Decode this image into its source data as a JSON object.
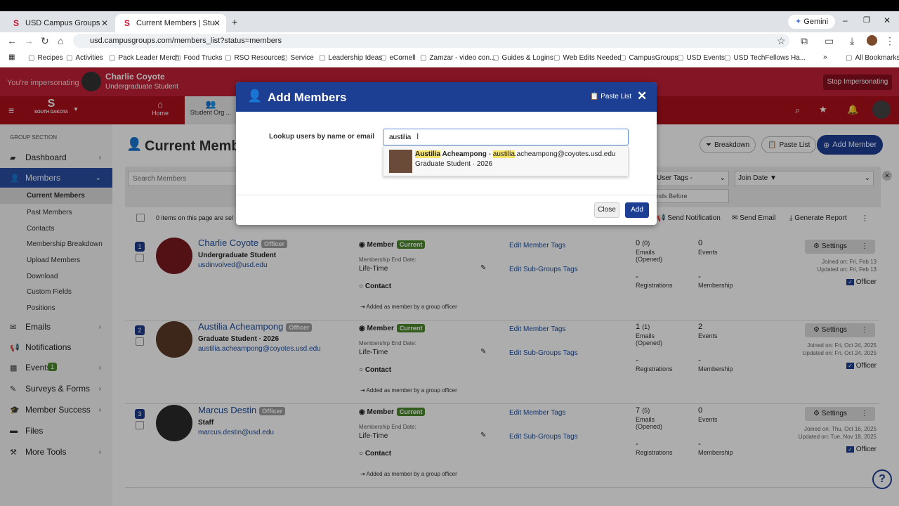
{
  "browser": {
    "tabs": [
      {
        "label": "USD Campus Groups"
      },
      {
        "label": "Current Members | Student Org"
      }
    ],
    "gemini_label": "Gemini",
    "url": "usd.campusgroups.com/members_list?status=members",
    "bookmarks": [
      "Recipes",
      "Activities",
      "Pack Leader Merch",
      "Food Trucks",
      "RSO Resources",
      "Service",
      "Leadership Ideas",
      "eCornell",
      "Zamzar - video con...",
      "Guides & Logins",
      "Web Edits Needed",
      "CampusGroups",
      "USD Events",
      "USD TechFellows Ha...",
      "All Bookmarks"
    ]
  },
  "impersonation": {
    "label": "You're impersonating",
    "user_name": "Charlie Coyote",
    "user_role": "Undergraduate Student",
    "stop_button": "Stop Impersonating"
  },
  "nav": {
    "home": "Home",
    "student_org": "Student Org ..."
  },
  "sidebar": {
    "section_header": "GROUP SECTION",
    "items": [
      {
        "label": "Dashboard"
      },
      {
        "label": "Members"
      },
      {
        "label": "Emails"
      },
      {
        "label": "Notifications"
      },
      {
        "label": "Events",
        "badge": "1"
      },
      {
        "label": "Surveys & Forms"
      },
      {
        "label": "Member Success"
      },
      {
        "label": "Files"
      },
      {
        "label": "More Tools"
      }
    ],
    "sub_items": [
      "Current Members",
      "Past Members",
      "Contacts",
      "Membership Breakdown",
      "Upload Members",
      "Download",
      "Custom Fields",
      "Positions"
    ]
  },
  "main": {
    "title": "Current Members",
    "breakdown": "Breakdown",
    "paste_list": "Paste List",
    "add_member": "Add Member",
    "search_placeholder": "Search Members",
    "user_tags": "User Tags -",
    "join_date": "Join Date ▼",
    "ends_before": "nds Before",
    "selected_text": "0 items on this page are sel",
    "send_notification": "Send Notification",
    "send_email": "Send Email",
    "generate_report": "Generate Report",
    "members": [
      {
        "num": "1",
        "name": "Charlie Coyote",
        "badge": "Officer",
        "role": "Undergraduate Student",
        "email": "usdinvolved@usd.edu",
        "member_label": "Member",
        "status": "Current",
        "end_label": "Membership End Date:",
        "end_value": "Life-Time",
        "contact": "Contact",
        "added": "Added as member by a group officer",
        "edit_tags": "Edit Member Tags",
        "edit_subgroups": "Edit Sub-Groups Tags",
        "emails_count": "0",
        "emails_opened": "(0)",
        "emails_label": "Emails (Opened)",
        "events_count": "0",
        "events_label": "Events",
        "reg_count": "-",
        "reg_label": "Registrations",
        "mem_count": "-",
        "mem_label": "Membership",
        "settings": "Settings",
        "joined": "Joined on: Fri, Feb 13",
        "updated": "Updated on: Fri, Feb 13",
        "officer": "Officer"
      },
      {
        "num": "2",
        "name": "Austilia Acheampong",
        "badge": "Officer",
        "role": "Graduate Student · 2026",
        "email": "austilia.acheampong@coyotes.usd.edu",
        "member_label": "Member",
        "status": "Current",
        "end_label": "Membership End Date:",
        "end_value": "Life-Time",
        "contact": "Contact",
        "added": "Added as member by a group officer",
        "edit_tags": "Edit Member Tags",
        "edit_subgroups": "Edit Sub-Groups Tags",
        "emails_count": "1",
        "emails_opened": "(1)",
        "emails_label": "Emails (Opened)",
        "events_count": "2",
        "events_label": "Events",
        "reg_count": "-",
        "reg_label": "Registrations",
        "mem_count": "-",
        "mem_label": "Membership",
        "settings": "Settings",
        "joined": "Joined on: Fri, Oct 24, 2025",
        "updated": "Updated on: Fri, Oct 24, 2025",
        "officer": "Officer"
      },
      {
        "num": "3",
        "name": "Marcus Destin",
        "badge": "Officer",
        "role": "Staff",
        "email": "marcus.destin@usd.edu",
        "member_label": "Member",
        "status": "Current",
        "end_label": "Membership End Date:",
        "end_value": "Life-Time",
        "contact": "Contact",
        "added": "Added as member by a group officer",
        "edit_tags": "Edit Member Tags",
        "edit_subgroups": "Edit Sub-Groups Tags",
        "emails_count": "7",
        "emails_opened": "(5)",
        "emails_label": "Emails (Opened)",
        "events_count": "0",
        "events_label": "Events",
        "reg_count": "-",
        "reg_label": "Registrations",
        "mem_count": "-",
        "mem_label": "Membership",
        "settings": "Settings",
        "joined": "Joined on: Thu, Oct 16, 2025",
        "updated": "Updated on: Tue, Nov 18, 2025",
        "officer": "Officer"
      }
    ]
  },
  "modal": {
    "title": "Add Members",
    "paste_list": "Paste List",
    "lookup_label": "Lookup users by name or email",
    "search_value": "austilia",
    "suggestion": {
      "name_highlight": "Austilia",
      "name_rest": " Acheampong",
      "sep": " - ",
      "email_highlight": "austilia",
      "email_rest": ".acheampong@coyotes.usd.edu",
      "sub": "Graduate Student · 2026"
    },
    "close": "Close",
    "add": "Add"
  }
}
